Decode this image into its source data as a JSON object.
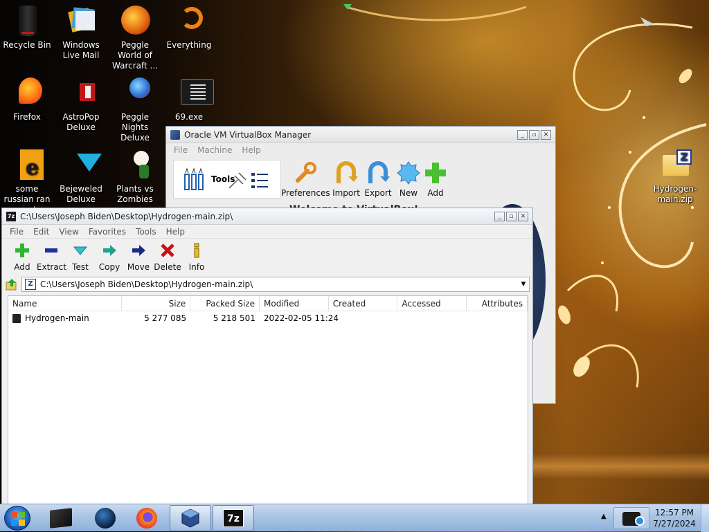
{
  "desktop": {
    "icons": [
      {
        "label": "Recycle Bin"
      },
      {
        "label": "Windows Live Mail"
      },
      {
        "label": "Peggle World of Warcraft ..."
      },
      {
        "label": "Everything"
      },
      {
        "label": "Firefox"
      },
      {
        "label": "AstroPop Deluxe"
      },
      {
        "label": "Peggle Nights Deluxe"
      },
      {
        "label": "69.exe"
      },
      {
        "label": "some russian ran a rat"
      },
      {
        "label": "Bejeweled Deluxe"
      },
      {
        "label": "Plants vs Zombies"
      },
      {
        "label": "Hydrogen-main.zip"
      }
    ]
  },
  "vbox": {
    "title": "Oracle VM VirtualBox Manager",
    "menu": [
      "File",
      "Machine",
      "Help"
    ],
    "tools_label": "Tools",
    "toolbar": [
      "Preferences",
      "Import",
      "Export",
      "New",
      "Add"
    ],
    "welcome": "Welcome to VirtualBox!"
  },
  "zip": {
    "title": "C:\\Users\\Joseph Biden\\Desktop\\Hydrogen-main.zip\\",
    "menu": [
      "File",
      "Edit",
      "View",
      "Favorites",
      "Tools",
      "Help"
    ],
    "toolbar": [
      "Add",
      "Extract",
      "Test",
      "Copy",
      "Move",
      "Delete",
      "Info"
    ],
    "address": "C:\\Users\\Joseph Biden\\Desktop\\Hydrogen-main.zip\\",
    "columns": [
      "Name",
      "Size",
      "Packed Size",
      "Modified",
      "Created",
      "Accessed",
      "Attributes"
    ],
    "rows": [
      {
        "name": "Hydrogen-main",
        "size": "5 277 085",
        "packed": "5 218 501",
        "modified": "2022-02-05 11:24",
        "created": "",
        "accessed": "",
        "attributes": ""
      }
    ]
  },
  "taskbar": {
    "time": "12:57 PM",
    "date": "7/27/2024"
  },
  "colors": {
    "zip_accent": "#1a1a1a",
    "taskbar": "#a9c4e4",
    "add_green": "#2fb52f",
    "delete_red": "#d01010"
  }
}
